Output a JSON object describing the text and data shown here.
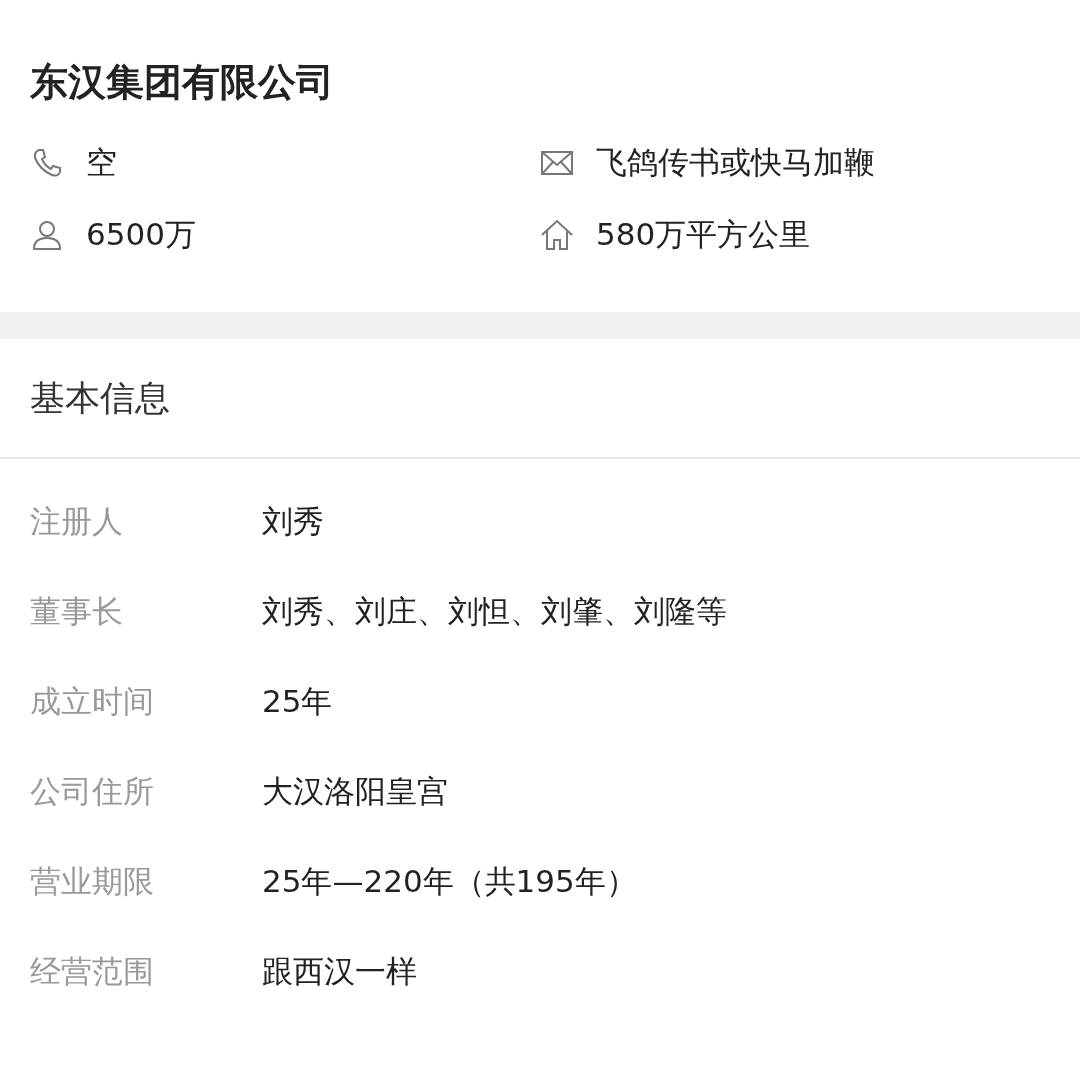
{
  "company": {
    "name": "东汉集团有限公司",
    "contacts": [
      {
        "kind": "phone",
        "text": "空"
      },
      {
        "kind": "mail",
        "text": "飞鸽传书或快马加鞭"
      },
      {
        "kind": "person",
        "text": "6500万"
      },
      {
        "kind": "house",
        "text": "580万平方公里"
      }
    ]
  },
  "basic_info": {
    "title": "基本信息",
    "rows": [
      {
        "label": "注册人",
        "value": "刘秀"
      },
      {
        "label": "董事长",
        "value": "刘秀、刘庄、刘怛、刘肇、刘隆等"
      },
      {
        "label": "成立时间",
        "value": "25年"
      },
      {
        "label": "公司住所",
        "value": "大汉洛阳皇宫"
      },
      {
        "label": "营业期限",
        "value": "25年—220年（共195年）"
      },
      {
        "label": "经营范围",
        "value": "跟西汉一样"
      }
    ]
  }
}
